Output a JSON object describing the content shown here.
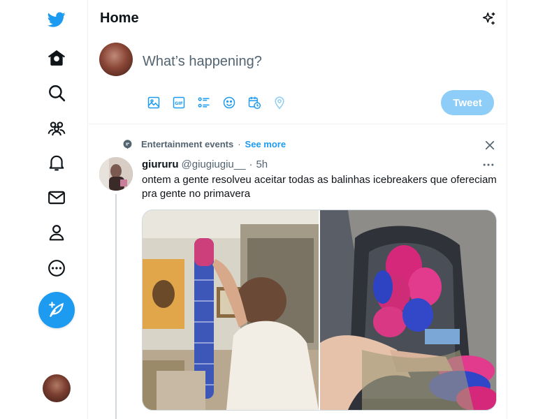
{
  "colors": {
    "accent": "#1d9bf0",
    "tweet_disabled": "#8ecdf7",
    "text": "#0f1419",
    "muted": "#536471",
    "border": "#eff3f4"
  },
  "nav": {
    "items": [
      {
        "icon": "twitter-logo-icon"
      },
      {
        "icon": "home-icon"
      },
      {
        "icon": "explore-search-icon"
      },
      {
        "icon": "communities-icon"
      },
      {
        "icon": "notifications-bell-icon"
      },
      {
        "icon": "messages-envelope-icon"
      },
      {
        "icon": "profile-icon"
      },
      {
        "icon": "more-circle-icon"
      }
    ],
    "compose_icon": "compose-feather-icon"
  },
  "header": {
    "title": "Home",
    "sparkle_icon": "sparkle-icon"
  },
  "composer": {
    "placeholder": "What’s happening?",
    "tools": [
      "image-icon",
      "gif-icon",
      "poll-icon",
      "emoji-icon",
      "schedule-icon",
      "location-icon"
    ],
    "tweet_label": "Tweet"
  },
  "tweet": {
    "context": {
      "topic": "Entertainment events",
      "separator": "·",
      "see_more": "See more"
    },
    "author": {
      "name": "giururu",
      "handle": "@giugiugiu__",
      "separator": "·",
      "time": "5h"
    },
    "text": "ontem a gente resolveu aceitar todas as balinhas icebreakers que ofereciam pra gente no primavera",
    "media_count": 2
  }
}
